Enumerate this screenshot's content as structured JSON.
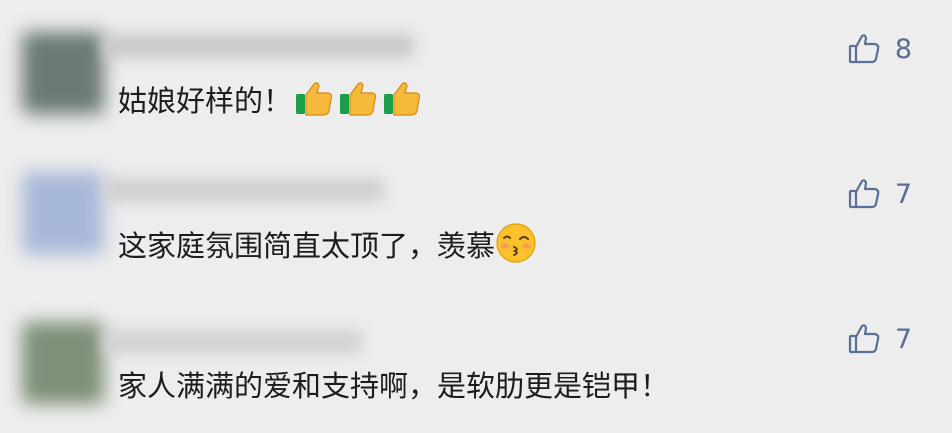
{
  "comments": [
    {
      "text": "姑娘好样的！",
      "emoji": [
        "thumbs-up-icon",
        "thumbs-up-icon",
        "thumbs-up-icon"
      ],
      "likes": "8",
      "avatar_color": "#6b7a72",
      "name_color": "#c9c9c9"
    },
    {
      "text": "这家庭氛围简直太顶了，羡慕",
      "emoji": [
        "kissing-face-icon"
      ],
      "likes": "7",
      "avatar_color": "#a8b8d8",
      "name_color": "#cfcfcf"
    },
    {
      "text": "家人满满的爱和支持啊，是软肋更是铠甲！",
      "emoji": [],
      "likes": "7",
      "avatar_color": "#7d9078",
      "name_color": "#d2d2d2"
    }
  ],
  "colors": {
    "background": "#ededed",
    "like_icon": "#5a6f96",
    "text": "#1c1c1c"
  }
}
